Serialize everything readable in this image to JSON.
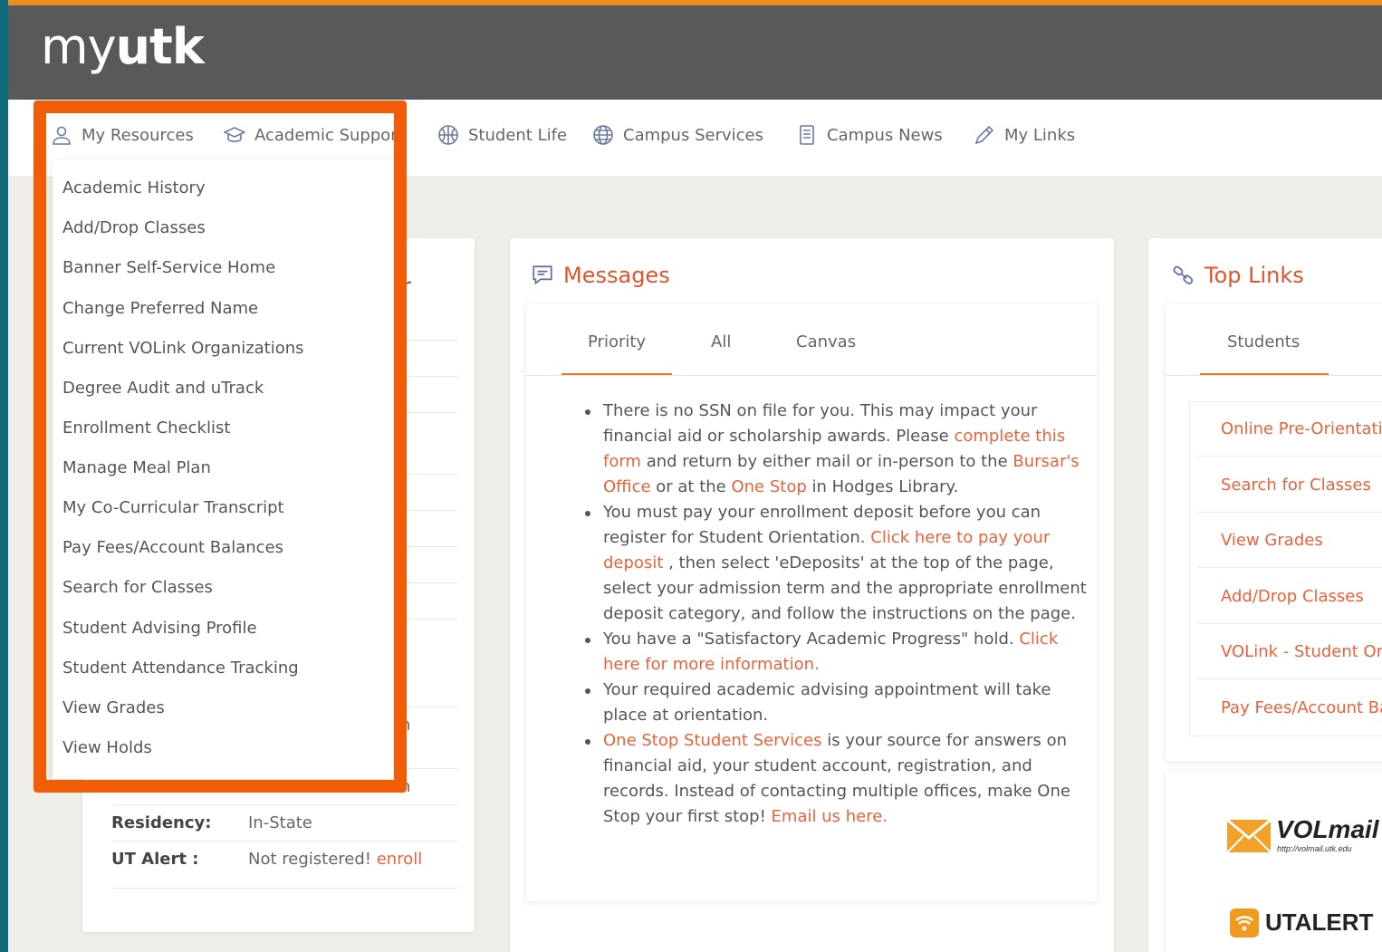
{
  "logo": {
    "light": "my",
    "bold": "utk"
  },
  "nav": [
    {
      "label": "My Resources",
      "icon": "user-icon"
    },
    {
      "label": "Academic Support",
      "icon": "graduation-cap-icon"
    },
    {
      "label": "Student Life",
      "icon": "basketball-icon"
    },
    {
      "label": "Campus Services",
      "icon": "globe-icon"
    },
    {
      "label": "Campus News",
      "icon": "document-icon"
    },
    {
      "label": "My Links",
      "icon": "pencil-icon"
    }
  ],
  "dropdown": [
    "Academic History",
    "Add/Drop Classes",
    "Banner Self-Service Home",
    "Change Preferred Name",
    "Current VOLink Organizations",
    "Degree Audit and uTrack",
    "Enrollment Checklist",
    "Manage Meal Plan",
    "My Co-Curricular Transcript",
    "Pay Fees/Account Balances",
    "Search for Classes",
    "Student Advising Profile",
    "Student Attendance Tracking",
    "View Grades",
    "View Holds"
  ],
  "left_card": {
    "title_fragment": "r",
    "row_fragment_1": "n",
    "row_fragment_2": "n",
    "residency_label": "Residency:",
    "residency_value": "In-State",
    "alert_label": "UT Alert :",
    "alert_value": "Not registered!",
    "alert_link": "enroll"
  },
  "messages": {
    "title": "Messages",
    "tabs": [
      "Priority",
      "All",
      "Canvas"
    ],
    "active_tab": "Priority",
    "items": [
      [
        {
          "t": "There is no SSN on file for you. This may impact your financial aid or scholarship awards. Please "
        },
        {
          "t": "complete this form",
          "link": true
        },
        {
          "t": " and return by either mail or in-person to the "
        },
        {
          "t": "Bursar's Office",
          "link": true
        },
        {
          "t": " or at the "
        },
        {
          "t": "One Stop",
          "link": true
        },
        {
          "t": " in Hodges Library."
        }
      ],
      [
        {
          "t": "You must pay your enrollment deposit before you can register for Student Orientation. "
        },
        {
          "t": "Click here to pay your deposit",
          "link": true
        },
        {
          "t": " , then select 'eDeposits' at the top of the page, select your admission term and the appropriate enrollment deposit category, and follow the instructions on the page."
        }
      ],
      [
        {
          "t": "You have a \"Satisfactory Academic Progress\" hold. "
        },
        {
          "t": "Click here for more information.",
          "link": true
        }
      ],
      [
        {
          "t": "Your required academic advising appointment will take place at orientation."
        }
      ],
      [
        {
          "t": "One Stop Student Services",
          "link": true
        },
        {
          "t": " is your source for answers on financial aid, your student account, registration, and records. Instead of contacting multiple offices, make One Stop your first stop!  "
        },
        {
          "t": "Email us here.",
          "link": true
        }
      ]
    ]
  },
  "top_links": {
    "title": "Top Links",
    "tab": "Students",
    "items": [
      "Online Pre-Orientation",
      "Search for Classes",
      "View Grades",
      "Add/Drop Classes",
      "VOLink - Student Organizations",
      "Pay Fees/Account Balances"
    ]
  },
  "volmail": {
    "name": "VOLmail",
    "url": "http://volmail.utk.edu"
  },
  "utalert": {
    "name": "UTALERT"
  },
  "colors": {
    "accent": "#e8623a",
    "highlight": "#f25c05",
    "header": "#58595b"
  }
}
